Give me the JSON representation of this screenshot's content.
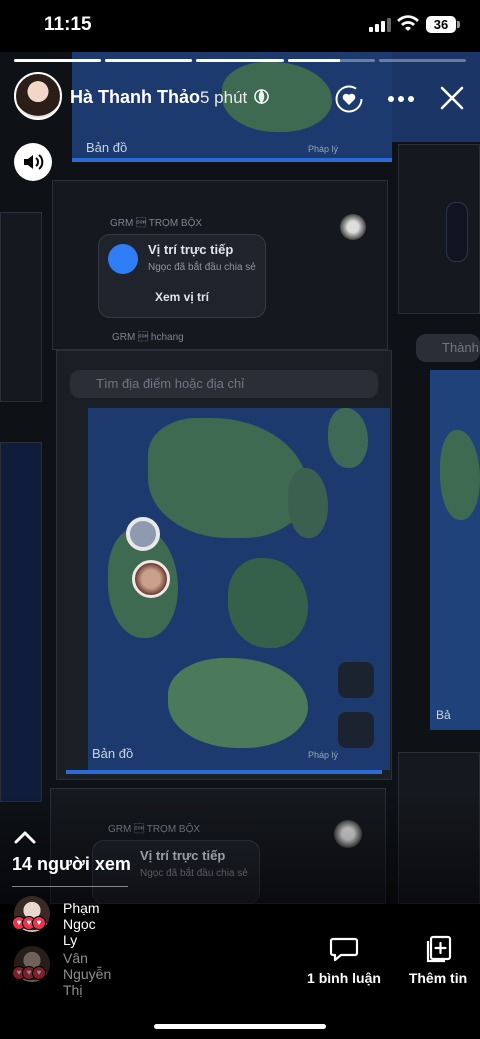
{
  "status_bar": {
    "time": "11:15",
    "battery": "36"
  },
  "story": {
    "progress": [
      1,
      1,
      1,
      0.6,
      0
    ],
    "author": "Hà Thanh Thảo",
    "time_ago": "5 phút",
    "viewers_count_label": "14 người xem"
  },
  "media": {
    "maps_label": "Bản đồ",
    "maps_label_short": "Bả",
    "legal_label": "Pháp lý",
    "tag_top_1": "GRM \u0001 TRỌM BỘX",
    "tag_top_2": "GRM \u0001 hchang",
    "live_location_title": "Vị trí trực tiếp",
    "live_location_sub": "Ngọc đã bắt đầu chia sẻ",
    "view_location_button": "Xem vị trí",
    "search_placeholder": "Tìm địa điểm hoặc địa chỉ",
    "side_label": "Thành T"
  },
  "viewers_list": [
    {
      "name": "Phạm Ngọc Ly",
      "dimmed": false
    },
    {
      "name": "Vân Nguyễn Thị",
      "dimmed": true
    }
  ],
  "actions": {
    "comments_label": "1 bình luận",
    "add_story_label": "Thêm tin"
  },
  "icons": [
    "signal-icon",
    "wifi-icon",
    "globe-icon",
    "heart-icon",
    "more-icon",
    "close-icon",
    "speaker-icon",
    "chevron-up-icon",
    "comment-icon",
    "add-story-icon"
  ],
  "colors": {
    "accent_blue": "#2f7df6",
    "reaction_red": "#e8364f",
    "map_water": "#1d3a6e"
  }
}
